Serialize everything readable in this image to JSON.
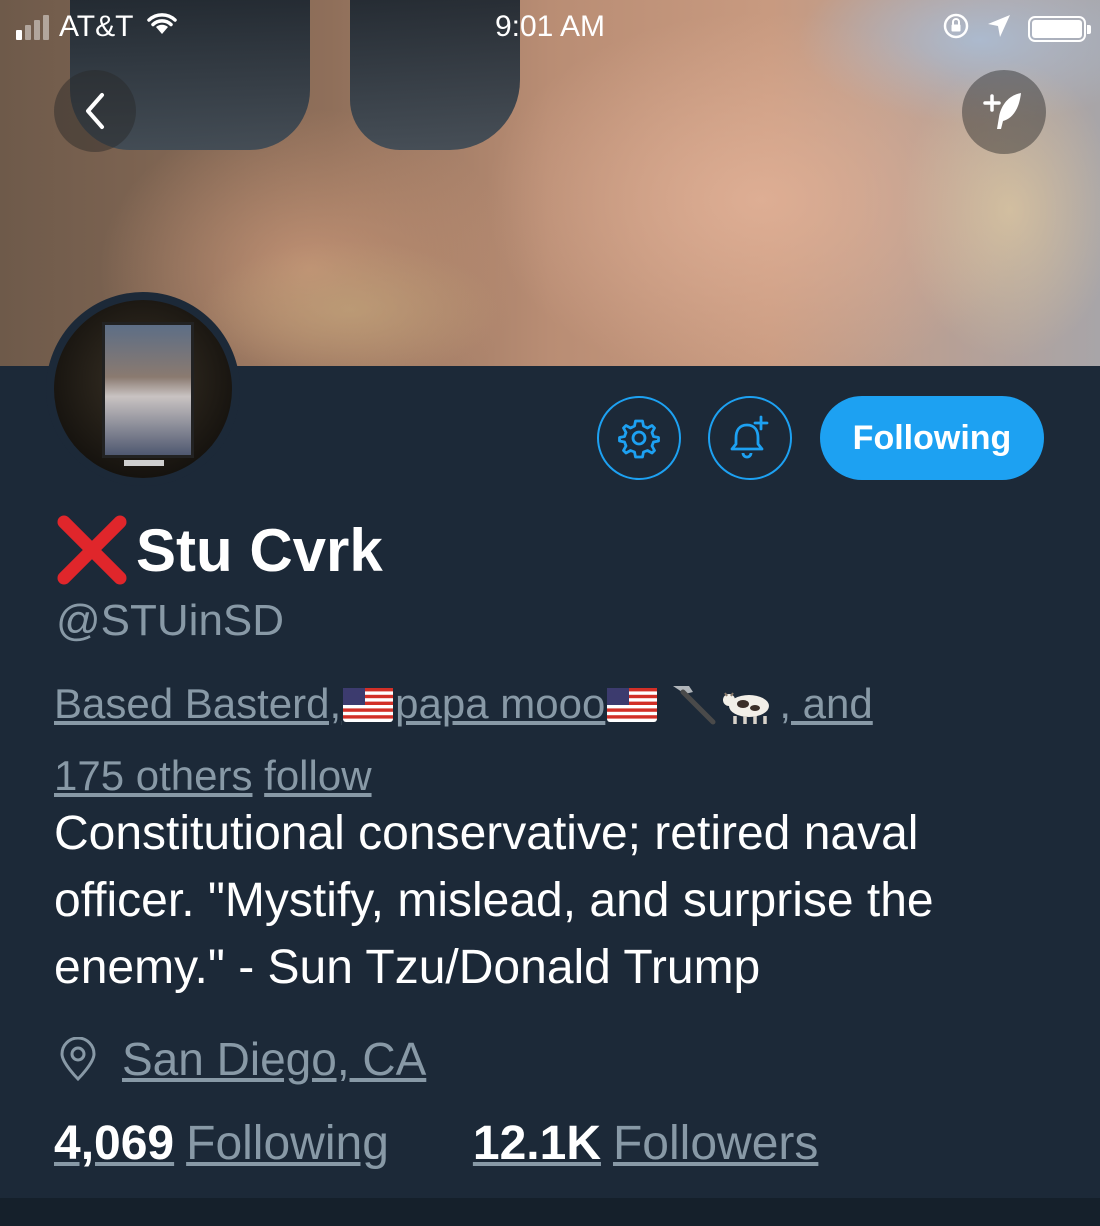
{
  "status_bar": {
    "carrier": "AT&T",
    "time": "9:01 AM",
    "signal_bars": 4,
    "signal_bars_filled": 1,
    "battery_level": 1.0,
    "icons": [
      "wifi-icon",
      "rotation-lock-icon",
      "location-arrow-icon",
      "battery-icon"
    ]
  },
  "header": {
    "back_icon": "chevron-left-icon",
    "compose_icon": "compose-tweet-icon"
  },
  "actions": {
    "settings_icon": "gear-icon",
    "notifications_icon": "bell-plus-icon",
    "follow_label": "Following"
  },
  "profile": {
    "name_prefix_icon": "cross-mark-icon",
    "display_name": "Stu Cvrk",
    "handle": "@STUinSD",
    "followed_by": {
      "name1": "Based Basterd,",
      "name2": "papa mooo",
      "name2_emojis": [
        "us-flag-icon",
        "us-flag-icon",
        "hammer-icon",
        "cow-icon"
      ],
      "and_text": ", and",
      "others": "175 others",
      "suffix": "follow"
    },
    "bio": "Constitutional conservative; retired naval officer. \"Mystify, mislead, and surprise the enemy.\" - Sun Tzu/Donald Trump",
    "location": "San Diego, CA",
    "location_icon": "location-pin-icon",
    "following_count": "4,069",
    "following_label": "Following",
    "followers_count": "12.1K",
    "followers_label": "Followers"
  },
  "colors": {
    "background": "#1c2938",
    "accent": "#1da1f2",
    "secondary_text": "#8899a6",
    "primary_text": "#ffffff"
  }
}
